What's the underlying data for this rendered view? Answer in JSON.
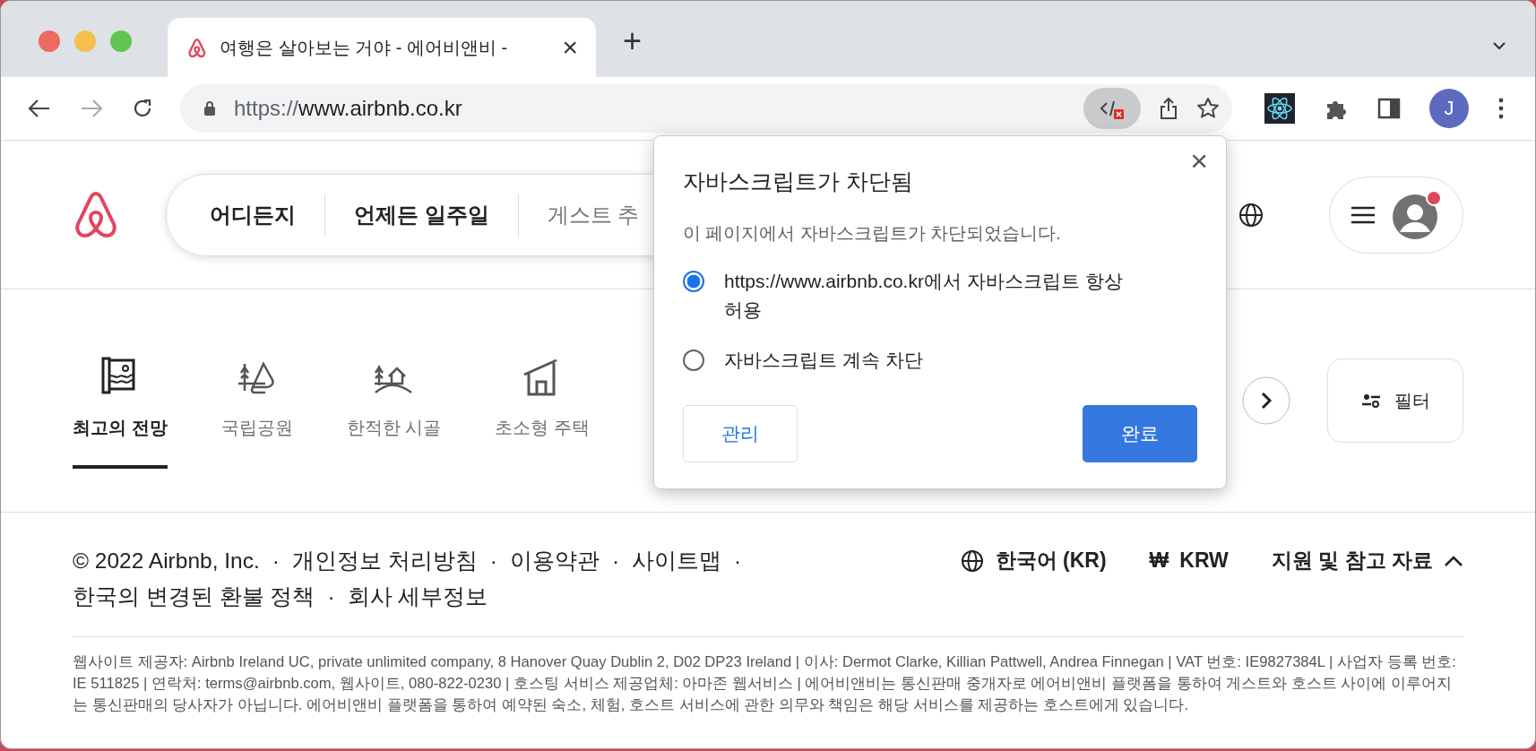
{
  "window": {
    "controls": [
      {
        "color": "#ed6a5e"
      },
      {
        "color": "#f5bf4f"
      },
      {
        "color": "#61c554"
      }
    ]
  },
  "tabs": [
    {
      "title": "여행은 살아보는 거야 - 에어비앤비 -",
      "close": "×",
      "selected": true
    }
  ],
  "new_tab": "+",
  "address_bar": {
    "scheme": "https://",
    "host": "www.airbnb.co.kr"
  },
  "profile": {
    "initial": "J"
  },
  "search": {
    "segments": [
      {
        "label": "어디든지",
        "kind": "value"
      },
      {
        "label": "언제든 일주일",
        "kind": "value"
      },
      {
        "label": "게스트 추",
        "kind": "placeholder"
      }
    ]
  },
  "categories": [
    {
      "label": "최고의 전망",
      "kind": "view",
      "selected": true
    },
    {
      "label": "국립공원",
      "kind": "park",
      "selected": false
    },
    {
      "label": "한적한 시골",
      "kind": "countryside",
      "selected": false
    },
    {
      "label": "초소형 주택",
      "kind": "tiny",
      "selected": false
    }
  ],
  "filter": {
    "label": "필터"
  },
  "footer": {
    "links": [
      "© 2022 Airbnb, Inc.",
      "개인정보 처리방침",
      "이용약관",
      "사이트맵",
      "한국의 변경된 환불 정책",
      "회사 세부정보"
    ],
    "separator": "·",
    "language": "한국어 (KR)",
    "currency_symbol": "₩",
    "currency": "KRW",
    "support": "지원 및 참고 자료"
  },
  "legal": "웹사이트 제공자: Airbnb Ireland UC, private unlimited company, 8 Hanover Quay Dublin 2, D02 DP23 Ireland | 이사: Dermot Clarke, Killian Pattwell, Andrea Finnegan | VAT 번호: IE9827384L | 사업자 등록 번호: IE 511825 | 연락처: terms@airbnb.com, 웹사이트, 080-822-0230 | 호스팅 서비스 제공업체: 아마존 웹서비스 | 에어비앤비는 통신판매 중개자로 에어비앤비 플랫폼을 통하여 게스트와 호스트 사이에 이루어지는 통신판매의 당사자가 아닙니다. 에어비앤비 플랫폼을 통하여 예약된 숙소, 체험, 호스트 서비스에 관한 의무와 책임은 해당 서비스를 제공하는 호스트에게 있습니다.",
  "dialog": {
    "title": "자바스크립트가 차단됨",
    "message": "이 페이지에서 자바스크립트가 차단되었습니다.",
    "options": [
      {
        "label": "https://www.airbnb.co.kr에서 자바스크립트 항상 허용",
        "selected": true
      },
      {
        "label": "자바스크립트 계속 차단",
        "selected": false
      }
    ],
    "manage": "관리",
    "done": "완료",
    "close": "×"
  }
}
